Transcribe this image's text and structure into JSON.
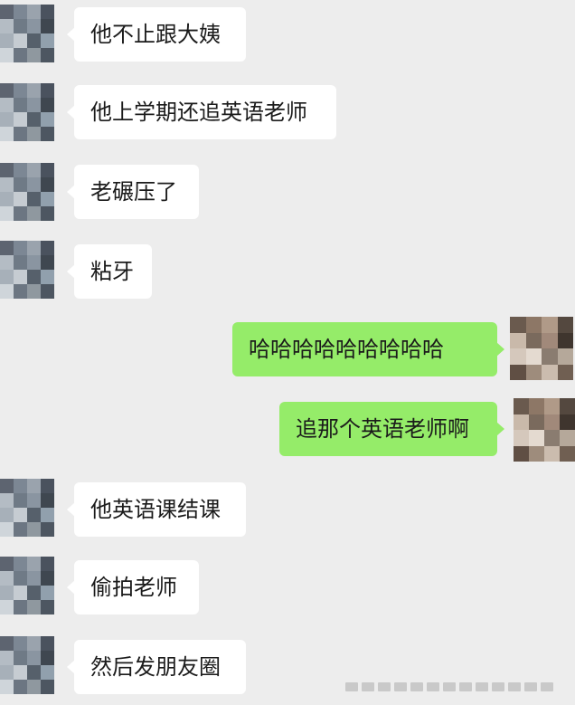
{
  "chat": {
    "messages": [
      {
        "side": "in",
        "text": "他不止跟大姨"
      },
      {
        "side": "in",
        "text": "他上学期还追英语老师"
      },
      {
        "side": "in",
        "text": "老碾压了"
      },
      {
        "side": "in",
        "text": "粘牙"
      },
      {
        "side": "out",
        "text": "哈哈哈哈哈哈哈哈哈"
      },
      {
        "side": "out",
        "text": "追那个英语老师啊"
      },
      {
        "side": "in",
        "text": "他英语课结课"
      },
      {
        "side": "in",
        "text": "偷拍老师"
      },
      {
        "side": "in",
        "text": "然后发朋友圈"
      }
    ]
  },
  "colors": {
    "background": "#ededed",
    "incoming_bubble": "#ffffff",
    "outgoing_bubble": "#95ec69",
    "text": "#1b1b1b"
  },
  "icons": {
    "incoming_avatar": "pixelated-avatar-icon",
    "outgoing_avatar": "pixelated-avatar-icon"
  }
}
